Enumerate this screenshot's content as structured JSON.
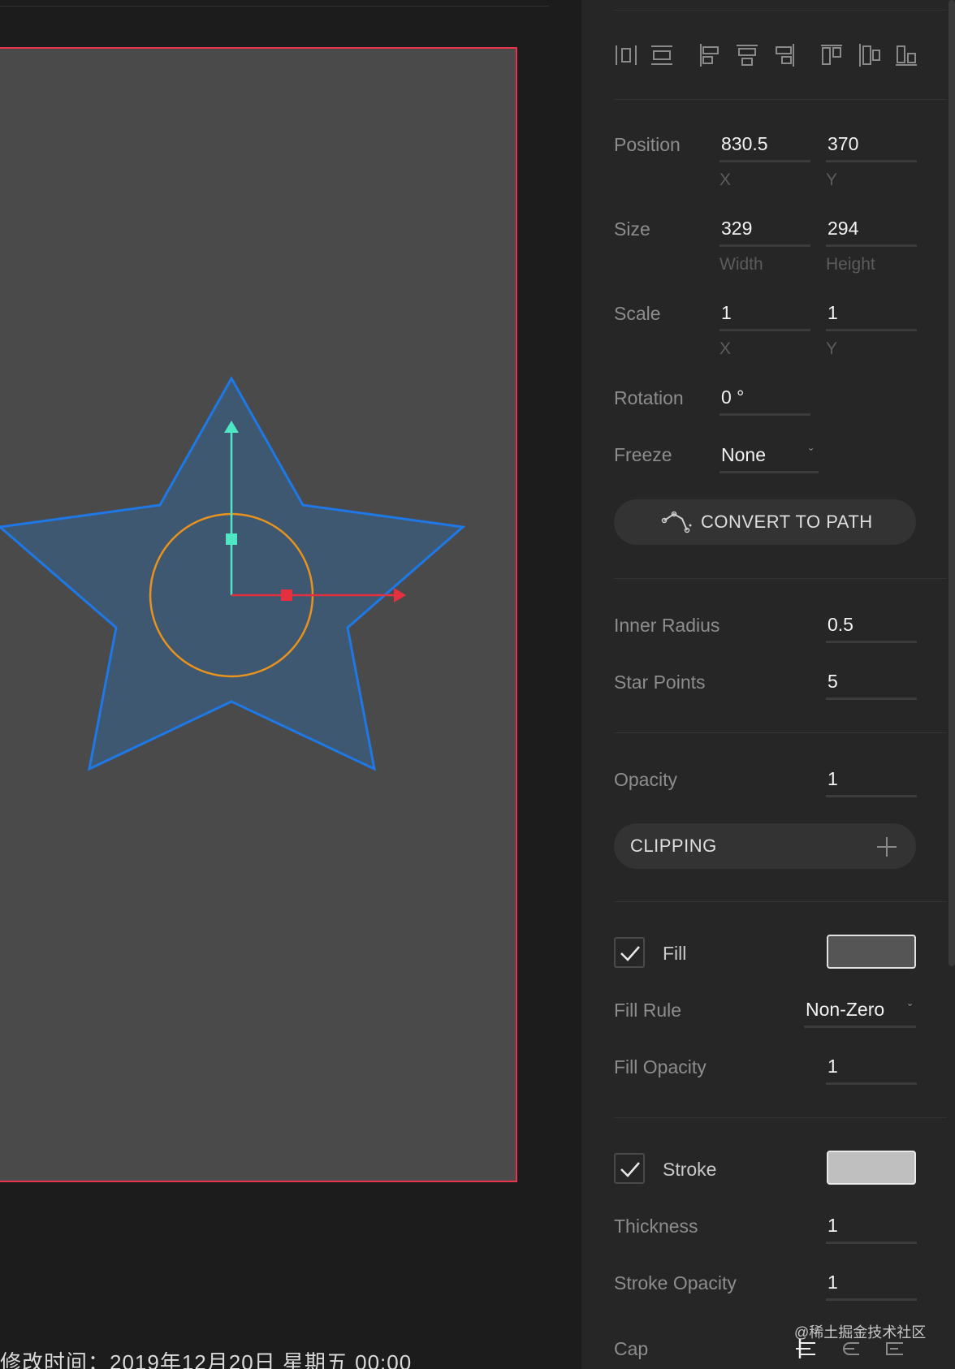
{
  "colors": {
    "artboard_border": "#e8344f",
    "artboard_fill": "#4a4a4a",
    "star_outline": "#1e78e6",
    "star_fill": "#3f5872",
    "pivot_circle": "#e8931c",
    "y_axis": "#4fe6c3",
    "x_axis": "#e5303f",
    "fill_swatch": "#555555",
    "stroke_swatch": "#bfbfbf"
  },
  "canvas": {
    "footer_text": "修改时间：2019年12月20日 星期五 00:00"
  },
  "align_toolbar": {
    "icons": [
      "distribute-horizontal-icon",
      "distribute-vertical-icon",
      "align-left-icon",
      "align-center-horizontal-icon",
      "align-right-icon",
      "align-top-icon",
      "align-center-vertical-icon",
      "align-bottom-icon"
    ]
  },
  "transform": {
    "position": {
      "label": "Position",
      "x": "830.5",
      "y": "370",
      "x_caption": "X",
      "y_caption": "Y"
    },
    "size": {
      "label": "Size",
      "width": "329",
      "height": "294",
      "width_caption": "Width",
      "height_caption": "Height"
    },
    "scale": {
      "label": "Scale",
      "x": "1",
      "y": "1",
      "x_caption": "X",
      "y_caption": "Y"
    },
    "rotation": {
      "label": "Rotation",
      "value": "0 °"
    },
    "freeze": {
      "label": "Freeze",
      "value": "None"
    },
    "convert_button": "CONVERT TO PATH"
  },
  "star": {
    "inner_radius": {
      "label": "Inner Radius",
      "value": "0.5"
    },
    "star_points": {
      "label": "Star Points",
      "value": "5"
    }
  },
  "appearance": {
    "opacity": {
      "label": "Opacity",
      "value": "1"
    },
    "clipping_button": "CLIPPING"
  },
  "fill": {
    "checked": true,
    "label": "Fill",
    "fill_rule": {
      "label": "Fill Rule",
      "value": "Non-Zero"
    },
    "fill_opacity": {
      "label": "Fill Opacity",
      "value": "1"
    }
  },
  "stroke": {
    "checked": true,
    "label": "Stroke",
    "thickness": {
      "label": "Thickness",
      "value": "1"
    },
    "stroke_opacity": {
      "label": "Stroke Opacity",
      "value": "1"
    },
    "cap": {
      "label": "Cap",
      "options": [
        "butt-cap-icon",
        "round-cap-icon",
        "square-cap-icon"
      ],
      "selected": "butt-cap-icon"
    }
  },
  "watermark": "@稀土掘金技术社区"
}
